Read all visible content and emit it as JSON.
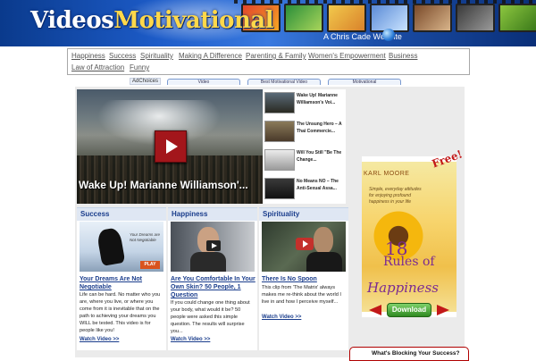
{
  "banner": {
    "logo_part1": "Videos",
    "logo_part2": "Motivational",
    "tagline": "A Chris Cade Website"
  },
  "nav": {
    "items": [
      "Happiness",
      "Success",
      "Spirituality",
      "Making A Difference",
      "Parenting & Family",
      "Women's Empowerment",
      "Business",
      "Law of Attraction",
      "Funny"
    ]
  },
  "ads": {
    "adchoices": "AdChoices",
    "tabs": [
      "Video",
      "Best Motivational Video",
      "Motivational"
    ]
  },
  "featured": {
    "title": "Wake Up! Marianne Williamson'...",
    "list": [
      "Wake Up! Marianne Williamson's Voi...",
      "The Unsung Hero – A Thai Commercie...",
      "Will You Still \"Be The Change...",
      "No Means NO – The Anti-Sexual Assa..."
    ]
  },
  "columns": [
    {
      "category": "Success",
      "image_text": "Your Dreams are Not Negotiable",
      "image_badge": "PLAY",
      "title": "Your Dreams Are Not Negotiable",
      "description": "Life can be hard. No matter who you are, where you live, or where you come from it is inevitable that on the path to achieving your dreams you WILL be tested. This video is for people like you!",
      "watch": "Watch Video >>"
    },
    {
      "category": "Happiness",
      "title": "Are You Comfortable In Your Own Skin? 50 People, 1 Question",
      "description": "If you could change one thing about your body, what would it be? 50 people were asked this simple question. The results will surprise you...",
      "watch": "Watch Video >>"
    },
    {
      "category": "Spirituality",
      "title": "There Is No Spoon",
      "description": "This clip from 'The Matrix' always makes me re-think about the world I live in and how I perceive myself...",
      "watch": "Watch Video >>"
    }
  ],
  "book_ad": {
    "free": "Free!",
    "author": "KARL MOORE",
    "subtitle": "Simple, everyday attitudes for enjoying profound happiness in your life",
    "number": "18",
    "title_line": "Rules of",
    "title_end": "Happiness",
    "download": "Download"
  },
  "blocking": {
    "label": "What's Blocking Your Success?"
  }
}
